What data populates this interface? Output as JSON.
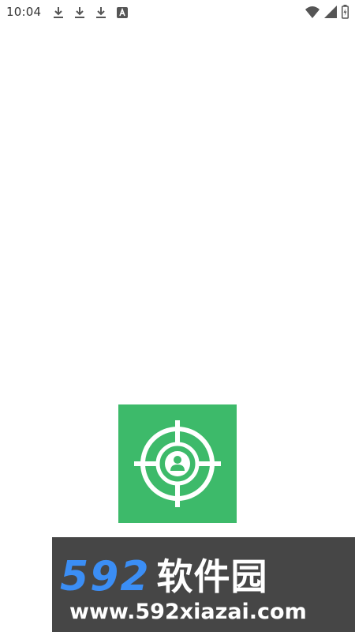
{
  "status_bar": {
    "time": "10:04",
    "left_icons": [
      "download-icon",
      "download-icon",
      "download-icon",
      "a-badge-icon"
    ],
    "right_icons": [
      "wifi-icon",
      "cellular-signal-icon",
      "battery-icon"
    ]
  },
  "splash": {
    "logo_icon": "target-user-icon",
    "background_color": "#3dba6a"
  },
  "watermark": {
    "brand_number": "592",
    "brand_name": "软件园",
    "url": "www.592xiazai.com",
    "brand_number_color": "#3b8ef5",
    "background_color": "#464646"
  }
}
